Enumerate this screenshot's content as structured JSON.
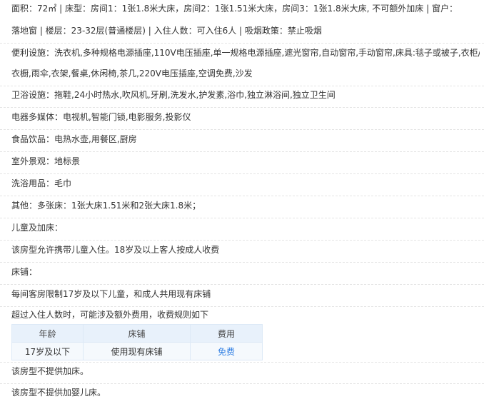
{
  "room_info": {
    "area_line": "面积：72㎡ | 床型：房间1：1张1.8米大床，房间2：1张1.51米大床，房间3：1张1.8米大床, 不可额外加床 | 窗户：",
    "floor_line": "落地窗 | 楼层：23-32层(普通楼层) | 入住人数：可入住6人 | 吸烟政策：禁止吸烟"
  },
  "facilities": {
    "convenience_line1": "便利设施：洗衣机,多种规格电源插座,110V电压插座,单一规格电源插座,遮光窗帘,自动窗帘,手动窗帘,床具:毯子或被子,衣柜/",
    "convenience_line2": "衣橱,雨伞,衣架,餐桌,休闲椅,茶几,220V电压插座,空调免费,沙发",
    "bathroom": "卫浴设施：拖鞋,24小时热水,吹风机,牙刷,洗发水,护发素,浴巾,独立淋浴间,独立卫生间",
    "media": "电器多媒体：电视机,智能门锁,电影服务,投影仪",
    "food": "食品饮品：电热水壶,用餐区,厨房",
    "view": "室外景观：地标景",
    "toiletries": "洗浴用品：毛巾",
    "other": "其他：多张床：1张大床1.51米和2张大床1.8米；"
  },
  "policy": {
    "children_heading": "儿童及加床：",
    "children_text": "该房型允许携带儿童入住。18岁及以上客人按成人收费",
    "bedding_heading": "床铺：",
    "bedding_text": "每间客房限制17岁及以下儿童，和成人共用现有床铺",
    "excess_text": "超过入住人数时，可能涉及额外费用，收费规则如下",
    "table": {
      "headers": [
        "年龄",
        "床铺",
        "费用"
      ],
      "rows": [
        [
          "17岁及以下",
          "使用现有床铺",
          "免费"
        ]
      ]
    },
    "no_extra_bed": "该房型不提供加床。",
    "no_crib": "该房型不提供加婴儿床。"
  },
  "colors": {
    "text": "#333333",
    "table_header_bg": "#e8f1fb",
    "table_body_bg": "#f5f9fd",
    "free_link": "#2f7ee3"
  }
}
